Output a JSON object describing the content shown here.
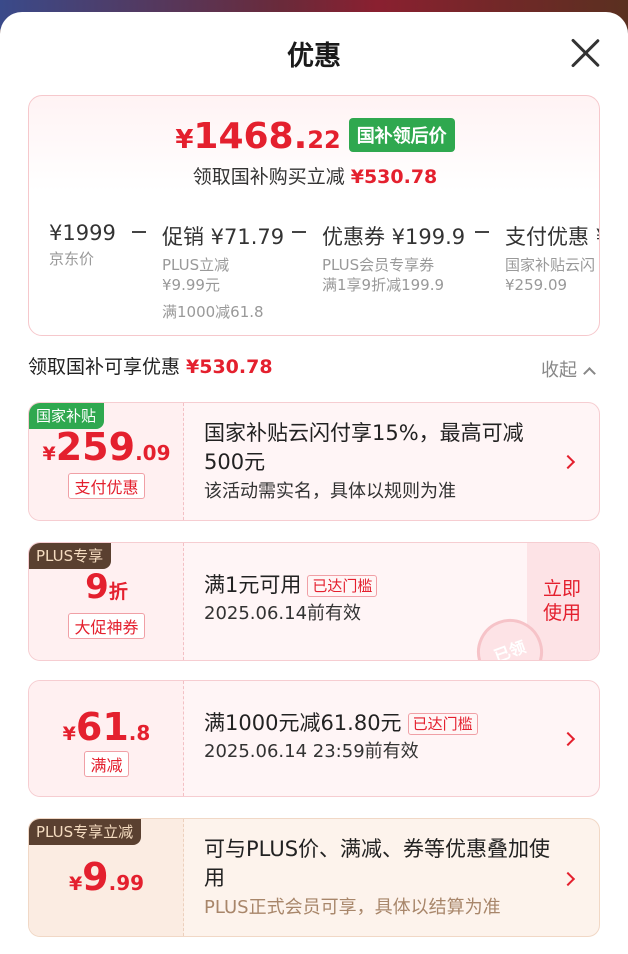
{
  "header": {
    "title": "优惠"
  },
  "summary": {
    "price_yen": "¥",
    "price_int": "1468.",
    "price_dec": "22",
    "price_tag": "国补领后价",
    "subtitle_label": "领取国补购买立减",
    "subtitle_amount": "¥530.78",
    "breakdown": [
      {
        "main": "¥1999",
        "lines": [
          "京东价"
        ]
      },
      {
        "main": "促销 ¥71.79",
        "lines": [
          "PLUS立减",
          "¥9.99元",
          "满1000减61.8"
        ]
      },
      {
        "main": "优惠券 ¥199.9",
        "lines": [
          "PLUS会员专享券",
          "满1享9折减199.9"
        ]
      },
      {
        "main": "支付优惠 ¥",
        "lines": [
          "国家补贴云闪",
          "¥259.09"
        ]
      }
    ]
  },
  "section": {
    "label": "领取国补可享优惠",
    "amount": "¥530.78",
    "collapse_label": "收起"
  },
  "offers": [
    {
      "tag": "国家补贴",
      "yen": "¥",
      "int": "259",
      "dec": ".09",
      "label": "支付优惠",
      "title": "国家补贴云闪付享15%，最高可减500元",
      "desc": "该活动需实名，具体以规则为准"
    },
    {
      "tag": "PLUS专享",
      "int": "9",
      "dec": "折",
      "label": "大促神券",
      "title": "满1元可用",
      "badge": "已达门槛",
      "desc": "2025.06.14前有效",
      "action": "立即使用",
      "stamp": "已领"
    },
    {
      "yen": "¥",
      "int": "61",
      "dec": ".8",
      "label": "满减",
      "title": "满1000元减61.80元",
      "badge": "已达门槛",
      "desc": "2025.06.14 23:59前有效"
    },
    {
      "tag": "PLUS专享立减",
      "yen": "¥",
      "int": "9",
      "dec": ".99",
      "title": "可与PLUS价、满减、券等优惠叠加使用",
      "desc": "PLUS正式会员可享，具体以结算为准"
    }
  ],
  "colors": {
    "accent_red": "#e4202e",
    "green_tag": "#2fa84f",
    "plus_tag": "#5a4030"
  }
}
